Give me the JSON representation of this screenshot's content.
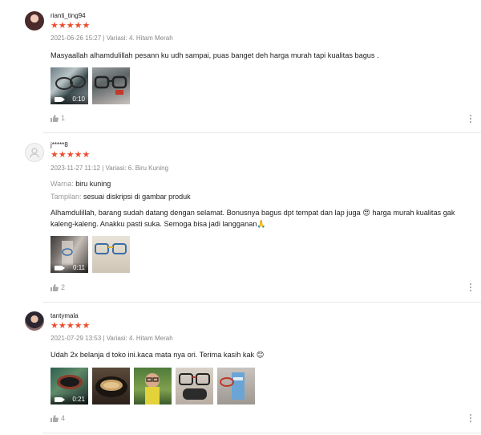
{
  "reviews": [
    {
      "username": "rianti_ting94",
      "stars": "★★★★★",
      "meta": "2021-06-26 15:27 | Variasi: 4. Hitam Merah",
      "comment": "Masyaallah alhamdulillah pesann ku udh sampai, puas banget deh harga murah tapi kualitas bagus .",
      "video_duration": "0:10",
      "likes": "1"
    },
    {
      "username": "j*****8",
      "stars": "★★★★★",
      "meta": "2023-11-27 11:12 | Variasi: 6. Biru Kuning",
      "warna_label": "Warna:",
      "warna_value": "biru kuning",
      "tampilan_label": "Tampilan:",
      "tampilan_value": "sesuai diskripsi di gambar produk",
      "comment": "Alhamdulillah, barang sudah datang dengan selamat. Bonusnya bagus dpt tempat dan lap juga 😍 harga murah kualitas gak kaleng-kaleng. Anakku pasti suka. Semoga bisa jadi langganan🙏",
      "video_duration": "0:11",
      "likes": "2"
    },
    {
      "username": "tantymala",
      "stars": "★★★★★",
      "meta": "2021-07-29 13:53 | Variasi: 4. Hitam Merah",
      "comment": "Udah 2x belanja d toko ini.kaca mata nya ori. Terima kasih kak 😊",
      "video_duration": "0:21",
      "likes": "4"
    }
  ],
  "colors": {
    "star": "#ee4d2d",
    "meta": "#888888",
    "divider": "#e8e8e8"
  },
  "icons": [
    "thumbs-up-icon",
    "more-vertical-icon",
    "video-camera-icon",
    "default-avatar-icon"
  ]
}
